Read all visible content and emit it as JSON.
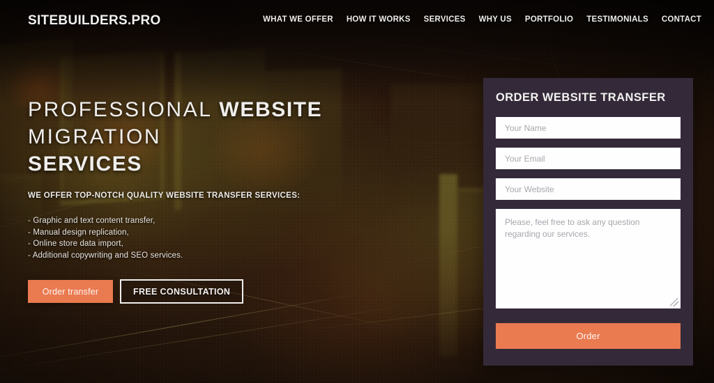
{
  "header": {
    "logo": "SITEBUILDERS.PRO",
    "nav": [
      {
        "label": "WHAT WE OFFER"
      },
      {
        "label": "HOW IT WORKS"
      },
      {
        "label": "SERVICES"
      },
      {
        "label": "WHY US"
      },
      {
        "label": "PORTFOLIO"
      },
      {
        "label": "TESTIMONIALS"
      },
      {
        "label": "CONTACT"
      }
    ]
  },
  "hero": {
    "headline_part1": "PROFESSIONAL ",
    "headline_bold1": "WEBSITE",
    "headline_part2": " MIGRATION",
    "headline_bold2": "SERVICES",
    "subhead": "WE OFFER TOP-NOTCH QUALITY WEBSITE TRANSFER SERVICES:",
    "bullets": [
      "- Graphic and text content transfer,",
      "- Manual design replication,",
      "- Online store data import,",
      "- Additional copywriting and SEO services."
    ],
    "primary_button": "Order transfer",
    "secondary_button": "FREE CONSULTATION"
  },
  "order_form": {
    "title": "ORDER WEBSITE TRANSFER",
    "name_placeholder": "Your Name",
    "email_placeholder": "Your Email",
    "website_placeholder": "Your Website",
    "message_placeholder": "Please, feel free to ask any question regarding our services.",
    "submit_label": "Order",
    "name_value": "",
    "email_value": "",
    "website_value": "",
    "message_value": ""
  },
  "colors": {
    "accent_orange": "#ea7a50",
    "panel_background": "#332938",
    "field_background": "#fefefe",
    "text_light": "#f0eeec",
    "placeholder_grey": "#a9a5ac"
  }
}
